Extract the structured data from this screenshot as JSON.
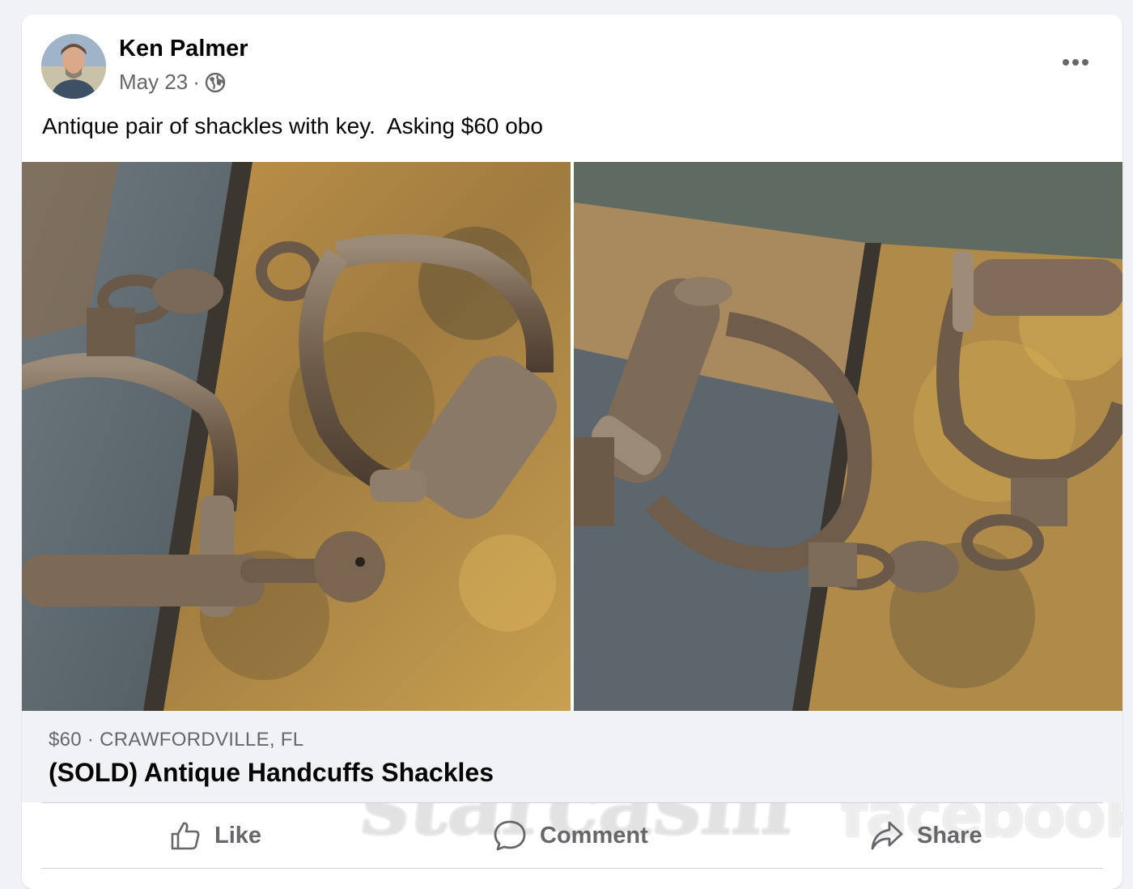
{
  "post": {
    "author": "Ken Palmer",
    "date": "May 23",
    "separator": "·",
    "privacy_icon": "globe-icon",
    "more_icon": "more-options-icon",
    "text": "Antique pair of shackles with key.  Asking $60 obo"
  },
  "photos": [
    {
      "description_icon": "photo-shackles-left"
    },
    {
      "description_icon": "photo-shackles-right"
    }
  ],
  "watermarks": {
    "left": "starcasm",
    "right": "facebook"
  },
  "listing": {
    "meta": "$60 · CRAWFORDVILLE, FL",
    "title": "(SOLD) Antique Handcuffs Shackles"
  },
  "actions": {
    "like": "Like",
    "comment": "Comment",
    "share": "Share"
  },
  "colors": {
    "background": "#f0f2f5",
    "card": "#ffffff",
    "secondary_text": "#65676b",
    "primary_text": "#050505"
  }
}
